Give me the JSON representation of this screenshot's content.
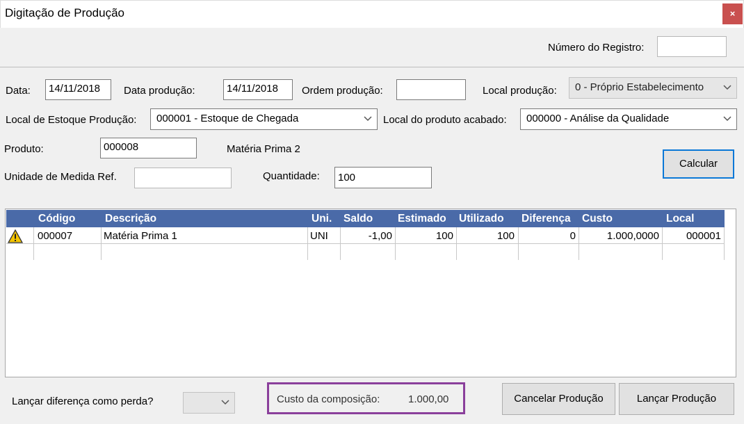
{
  "window": {
    "title": "Digitação de Produção",
    "close_symbol": "×"
  },
  "header": {
    "registro_label": "Número do Registro:",
    "registro_value": ""
  },
  "form": {
    "data_label": "Data:",
    "data_value": "14/11/2018",
    "data_producao_label": "Data produção:",
    "data_producao_value": "14/11/2018",
    "ordem_label": "Ordem produção:",
    "ordem_value": "",
    "local_producao_label": "Local produção:",
    "local_producao_value": "0 - Próprio Estabelecimento",
    "estoque_label": "Local de Estoque Produção:",
    "estoque_value": "000001 - Estoque de Chegada",
    "acabado_label": "Local do produto acabado:",
    "acabado_value": "000000 - Análise da Qualidade",
    "produto_label": "Produto:",
    "produto_value": "000008",
    "produto_desc": "Matéria Prima 2",
    "unidade_label": "Unidade de Medida Ref.",
    "unidade_value": "",
    "quantidade_label": "Quantidade:",
    "quantidade_value": "100",
    "calcular_label": "Calcular"
  },
  "grid": {
    "columns": [
      "Código",
      "Descrição",
      "Uni.",
      "Saldo",
      "Estimado",
      "Utilizado",
      "Diferença",
      "Custo",
      "Local"
    ],
    "rows": [
      {
        "icon": "warning-icon",
        "codigo": "000007",
        "descricao": "Matéria Prima 1",
        "uni": "UNI",
        "saldo": "-1,00",
        "estimado": "100",
        "utilizado": "100",
        "diferenca": "0",
        "custo": "1.000,0000",
        "local": "000001"
      }
    ]
  },
  "footer": {
    "perda_label": "Lançar diferença como perda?",
    "perda_value": "",
    "custo_label": "Custo da composição:",
    "custo_value": "1.000,00",
    "cancelar_label": "Cancelar Produção",
    "lancar_label": "Lançar Produção"
  },
  "colors": {
    "grid_header": "#4a6aa8",
    "close_button": "#c9504f",
    "highlight": "#8a3f9b",
    "focus": "#0a78d7"
  }
}
